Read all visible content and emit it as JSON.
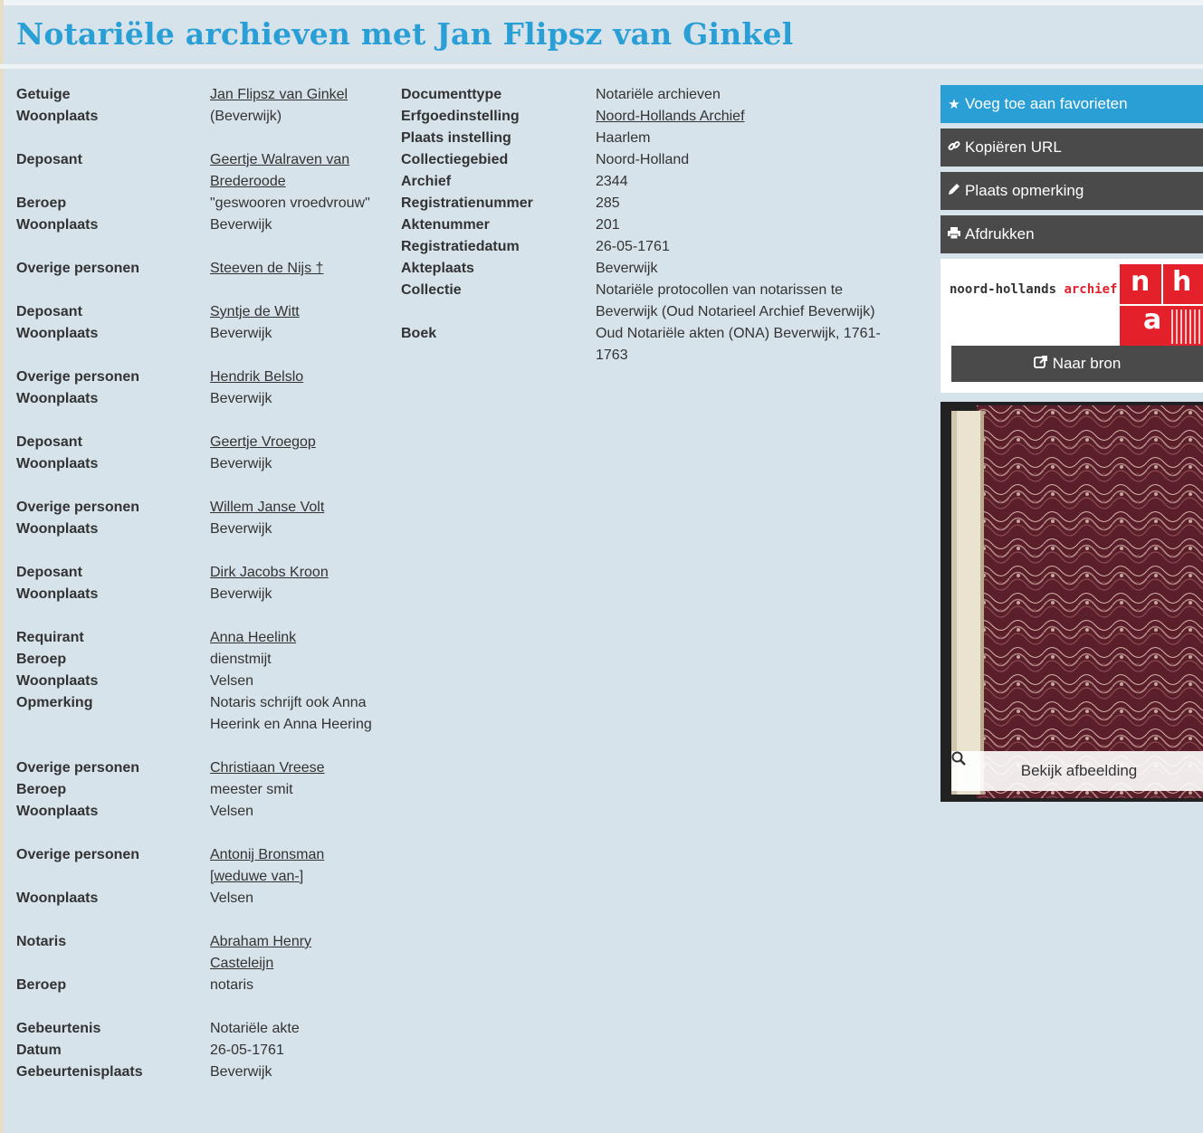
{
  "page": {
    "title": "Notariële archieven met Jan Flipsz van Ginkel"
  },
  "persons": [
    {
      "rows": [
        {
          "label": "Getuige",
          "value": "Jan Flipsz van Ginkel",
          "link": true
        },
        {
          "label": "Woonplaats",
          "value": "(Beverwijk)"
        }
      ]
    },
    {
      "rows": [
        {
          "label": "Deposant",
          "value": "Geertje Walraven van Brederoode",
          "link": true
        },
        {
          "label": "Beroep",
          "value": "\"geswooren vroedvrouw\""
        },
        {
          "label": "Woonplaats",
          "value": "Beverwijk"
        }
      ]
    },
    {
      "rows": [
        {
          "label": "Overige personen",
          "value": "Steeven de Nijs †",
          "link": true
        }
      ]
    },
    {
      "rows": [
        {
          "label": "Deposant",
          "value": "Syntje de Witt",
          "link": true
        },
        {
          "label": "Woonplaats",
          "value": "Beverwijk"
        }
      ]
    },
    {
      "rows": [
        {
          "label": "Overige personen",
          "value": "Hendrik Belslo",
          "link": true
        },
        {
          "label": "Woonplaats",
          "value": "Beverwijk"
        }
      ]
    },
    {
      "rows": [
        {
          "label": "Deposant",
          "value": "Geertje Vroegop",
          "link": true
        },
        {
          "label": "Woonplaats",
          "value": "Beverwijk"
        }
      ]
    },
    {
      "rows": [
        {
          "label": "Overige personen",
          "value": "Willem Janse Volt",
          "link": true
        },
        {
          "label": "Woonplaats",
          "value": "Beverwijk"
        }
      ]
    },
    {
      "rows": [
        {
          "label": "Deposant",
          "value": "Dirk Jacobs Kroon",
          "link": true
        },
        {
          "label": "Woonplaats",
          "value": "Beverwijk"
        }
      ]
    },
    {
      "rows": [
        {
          "label": "Requirant",
          "value": "Anna Heelink",
          "link": true
        },
        {
          "label": "Beroep",
          "value": "dienstmijt"
        },
        {
          "label": "Woonplaats",
          "value": "Velsen"
        },
        {
          "label": "Opmerking",
          "value": "Notaris schrijft ook Anna Heerink en Anna Heering"
        }
      ]
    },
    {
      "rows": [
        {
          "label": "Overige personen",
          "value": "Christiaan Vreese",
          "link": true
        },
        {
          "label": "Beroep",
          "value": "meester smit"
        },
        {
          "label": "Woonplaats",
          "value": "Velsen"
        }
      ]
    },
    {
      "rows": [
        {
          "label": "Overige personen",
          "value": "Antonij Bronsman [weduwe van-]",
          "link": true
        },
        {
          "label": "Woonplaats",
          "value": "Velsen"
        }
      ]
    },
    {
      "rows": [
        {
          "label": "Notaris",
          "value": "Abraham Henry Casteleijn",
          "link": true
        },
        {
          "label": "Beroep",
          "value": "notaris"
        }
      ]
    },
    {
      "rows": [
        {
          "label": "Gebeurtenis",
          "value": "Notariële akte"
        },
        {
          "label": "Datum",
          "value": "26-05-1761"
        },
        {
          "label": "Gebeurtenisplaats",
          "value": "Beverwijk"
        }
      ]
    }
  ],
  "document": [
    {
      "label": "Documenttype",
      "value": "Notariële archieven"
    },
    {
      "label": "Erfgoedinstelling",
      "value": "Noord-Hollands Archief",
      "link": true
    },
    {
      "label": "Plaats instelling",
      "value": "Haarlem"
    },
    {
      "label": "Collectiegebied",
      "value": "Noord-Holland"
    },
    {
      "label": "Archief",
      "value": "2344"
    },
    {
      "label": "Registratienummer",
      "value": "285"
    },
    {
      "label": "Aktenummer",
      "value": "201"
    },
    {
      "label": "Registratiedatum",
      "value": "26-05-1761"
    },
    {
      "label": "Akteplaats",
      "value": "Beverwijk"
    },
    {
      "label": "Collectie",
      "value": "Notariële protocollen van notarissen te Beverwijk (Oud Notarieel Archief Beverwijk)"
    },
    {
      "label": "Boek",
      "value": "Oud Notariële akten (ONA) Beverwijk, 1761-1763"
    }
  ],
  "sidebar": {
    "favorite_label": "Voeg toe aan favorieten",
    "copy_url_label": "Kopiëren URL",
    "remark_label": "Plaats opmerking",
    "print_label": "Afdrukken",
    "logo_text_main": "noord-hollands",
    "logo_text_accent": "archief",
    "logo_letters": [
      "n",
      "h",
      "a"
    ],
    "source_label": "Naar bron",
    "view_image_label": "Bekijk afbeelding"
  },
  "icons": {
    "favorite": "star-icon",
    "copy": "link-icon",
    "remark": "pencil-icon",
    "print": "print-icon",
    "source": "external-link-icon",
    "view": "search-icon"
  },
  "colors": {
    "accent": "#2a9fd6",
    "background": "#d7e3ea",
    "button": "#4a4a4a",
    "logo_red": "#e4202a"
  }
}
